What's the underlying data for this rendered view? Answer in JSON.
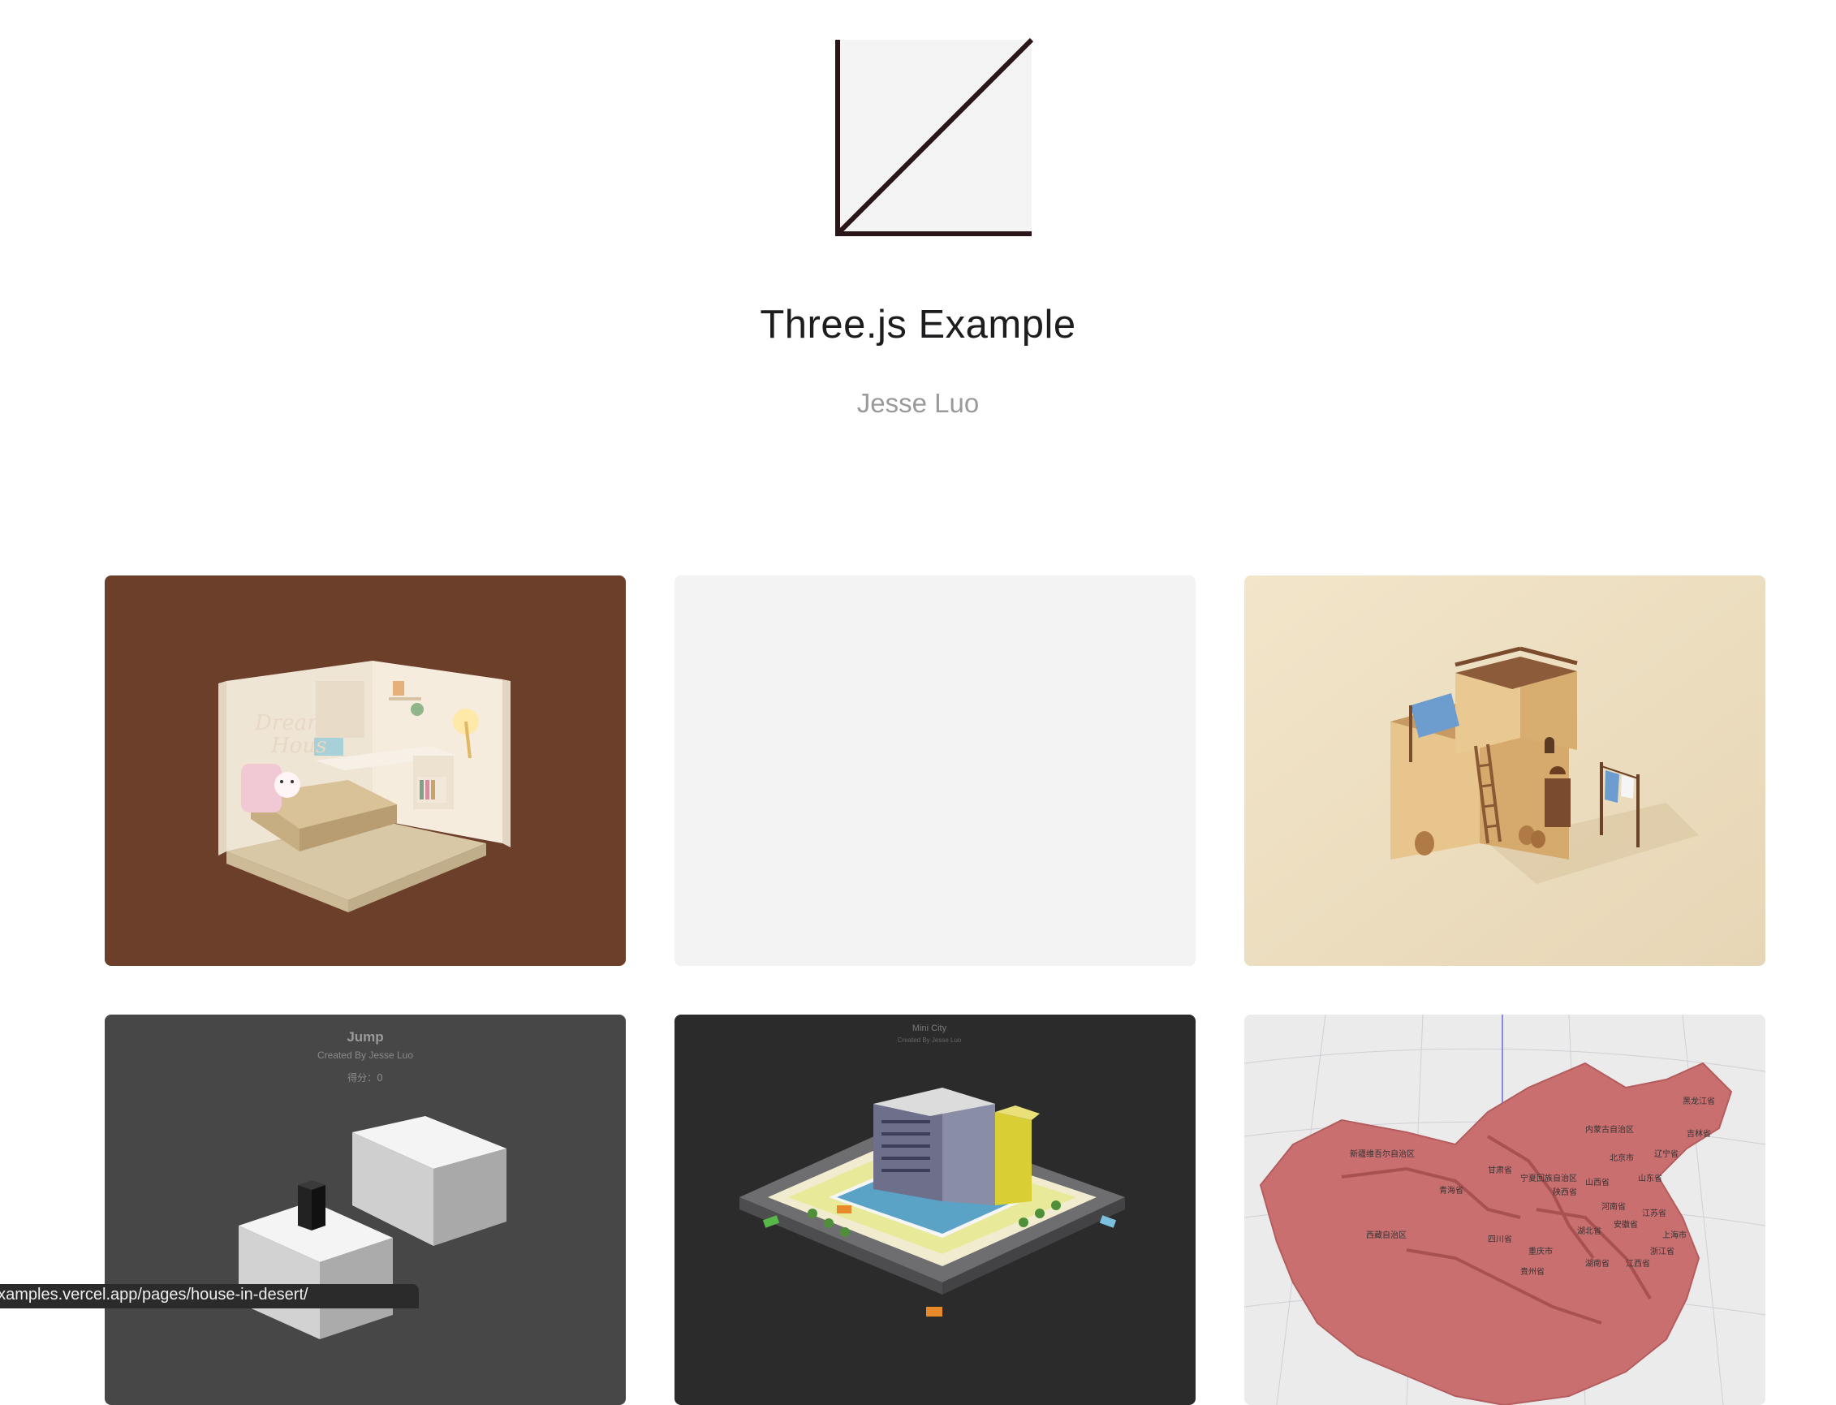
{
  "header": {
    "title": "Three.js Example",
    "author": "Jesse Luo"
  },
  "cards": [
    {
      "name": "Dream House",
      "bg": "#6b3f2a"
    },
    {
      "name": "",
      "bg": "#f3f3f3"
    },
    {
      "name": "House in Desert",
      "bg": "#f0e2c6"
    },
    {
      "name": "Jump",
      "bg": "#474747",
      "title": "Jump",
      "subtitle": "Created By Jesse Luo",
      "score": "得分：0"
    },
    {
      "name": "Mini City",
      "bg": "#2b2b2b",
      "title": "Mini City",
      "subtitle": "Created By Jesse Luo"
    },
    {
      "name": "China Map",
      "bg": "#ebebeb",
      "labels": [
        "黑龙江省",
        "内蒙古自治区",
        "吉林省",
        "新疆维吾尔自治区",
        "辽宁省",
        "宁夏回族自治区",
        "北京市",
        "甘肃省",
        "山西省",
        "山东省",
        "青海省",
        "陕西省",
        "河南省",
        "西藏自治区",
        "四川省",
        "湖北省",
        "江苏省",
        "上海市",
        "安徽省",
        "重庆市",
        "湖南省",
        "江西省",
        "浙江省",
        "贵州省"
      ]
    }
  ],
  "status_url": "examples.vercel.app/pages/house-in-desert/",
  "colors": {
    "logo_stroke": "#2a1518",
    "logo_fill": "#f4f4f4",
    "map_red": "#c96f70"
  }
}
